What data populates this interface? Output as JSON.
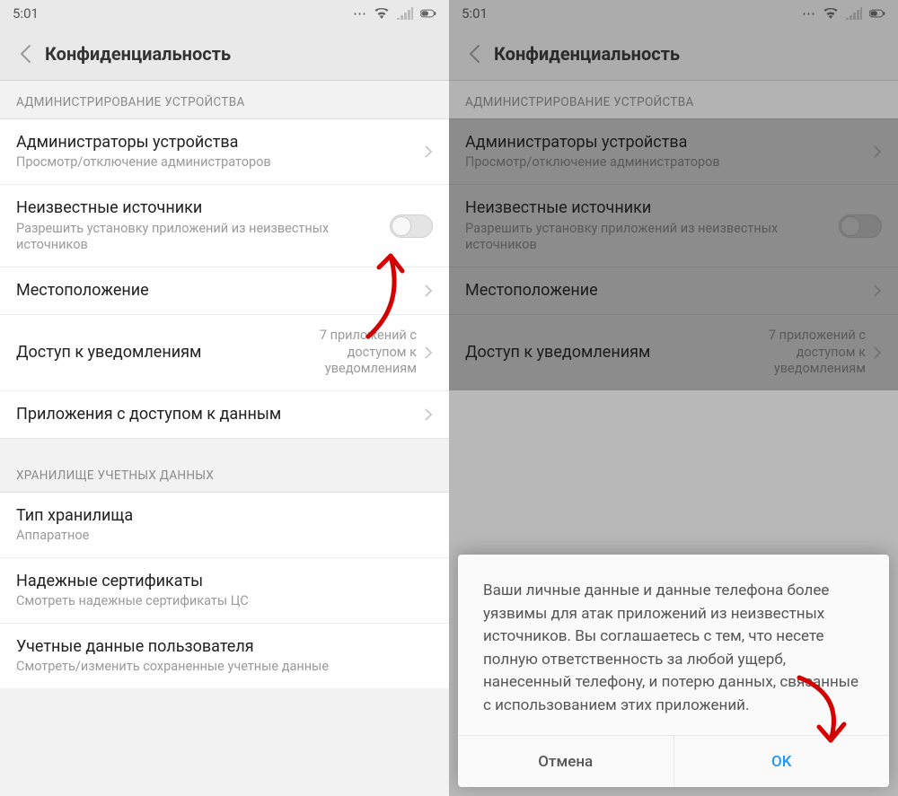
{
  "status": {
    "time": "5:01"
  },
  "header": {
    "title": "Конфиденциальность"
  },
  "sections": {
    "admin": {
      "header": "АДМИНИСТРИРОВАНИЕ УСТРОЙСТВА",
      "device_admins": {
        "title": "Администраторы устройства",
        "sub": "Просмотр/отключение администраторов"
      },
      "unknown_sources": {
        "title": "Неизвестные источники",
        "sub": "Разрешить установку приложений из неизвестных источников"
      },
      "location": {
        "title": "Местоположение"
      },
      "notif_access": {
        "title": "Доступ к уведомлениям",
        "value": "7 приложений с доступом к уведомлениям"
      },
      "data_access": {
        "title": "Приложения с доступом к данным"
      }
    },
    "creds": {
      "header": "ХРАНИЛИЩЕ УЧЕТНЫХ ДАННЫХ",
      "storage_type": {
        "title": "Тип хранилища",
        "sub": "Аппаратное"
      },
      "trusted": {
        "title": "Надежные сертификаты",
        "sub": "Смотреть надежные сертификаты ЦС"
      },
      "user_creds": {
        "title": "Учетные данные пользователя",
        "sub": "Смотреть/изменить сохраненные учетные данные"
      }
    }
  },
  "dialog": {
    "body": "Ваши личные данные и данные телефона более уязвимы для атак приложений из неизвестных источников. Вы соглашаетесь с тем, что несете полную ответственность за любой ущерб, нанесенный телефону, и потерю данных, связанные с использованием этих приложений.",
    "cancel": "Отмена",
    "ok": "OK"
  }
}
